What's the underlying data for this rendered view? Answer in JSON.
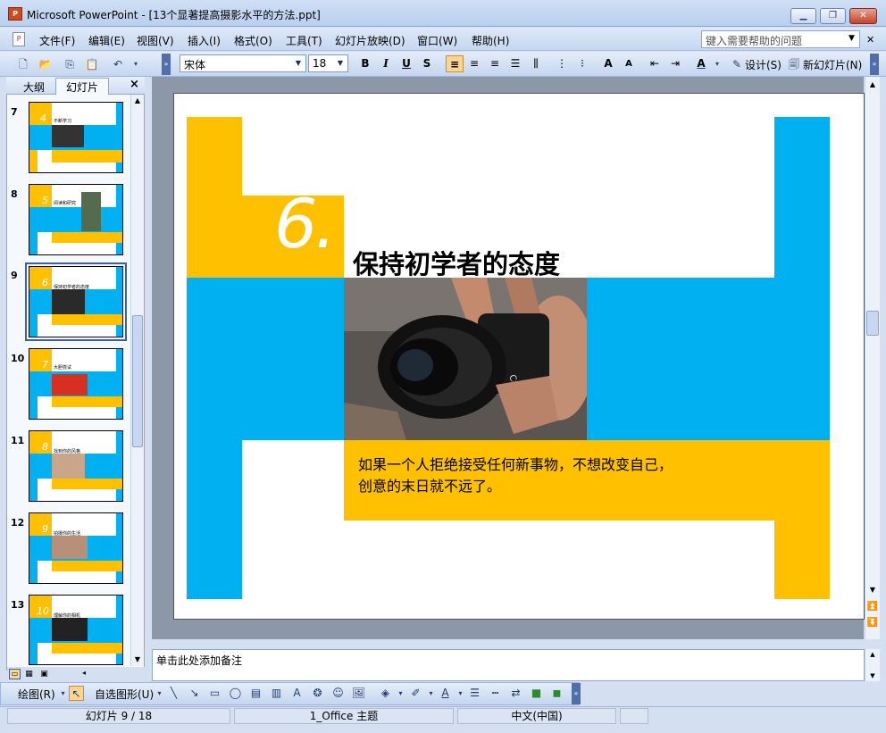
{
  "window": {
    "title": "Microsoft PowerPoint - [13个显著提高摄影水平的方法.ppt]",
    "app_icon": "powerpoint-icon"
  },
  "menu": {
    "items": [
      "文件(F)",
      "编辑(E)",
      "视图(V)",
      "插入(I)",
      "格式(O)",
      "工具(T)",
      "幻灯片放映(D)",
      "窗口(W)",
      "帮助(H)"
    ],
    "help_placeholder": "键入需要帮助的问题"
  },
  "toolbar": {
    "font_name": "宋体",
    "font_size": "18",
    "design_label": "设计(S)",
    "new_slide_label": "新幻灯片(N)"
  },
  "panel": {
    "tab_outline": "大纲",
    "tab_slides": "幻灯片",
    "close_glyph": "×",
    "thumbnails": [
      {
        "number": "7",
        "digit": "4",
        "title": "不断学习"
      },
      {
        "number": "8",
        "digit": "5",
        "title": "阅读和研究"
      },
      {
        "number": "9",
        "digit": "6",
        "title": "保持初学者的态度"
      },
      {
        "number": "10",
        "digit": "7",
        "title": "大胆尝试"
      },
      {
        "number": "11",
        "digit": "8",
        "title": "找到你的风格"
      },
      {
        "number": "12",
        "digit": "9",
        "title": "拍摄你的生活"
      },
      {
        "number": "13",
        "digit": "10",
        "title": "理解你的相机"
      }
    ]
  },
  "slide": {
    "number_text": "6.",
    "heading": "保持初学者的态度",
    "body_line1": "如果一个人拒绝接受任何新事物，不想改变自己，",
    "body_line2": "创意的末日就不远了。",
    "colors": {
      "yellow": "#FFC000",
      "blue": "#00B0F0"
    }
  },
  "notes": {
    "placeholder": "单击此处添加备注"
  },
  "drawbar": {
    "draw_label": "绘图(R)",
    "autoshape_label": "自选图形(U)"
  },
  "status": {
    "slide_pos": "幻灯片 9 / 18",
    "theme": "1_Office 主题",
    "language": "中文(中国)"
  }
}
